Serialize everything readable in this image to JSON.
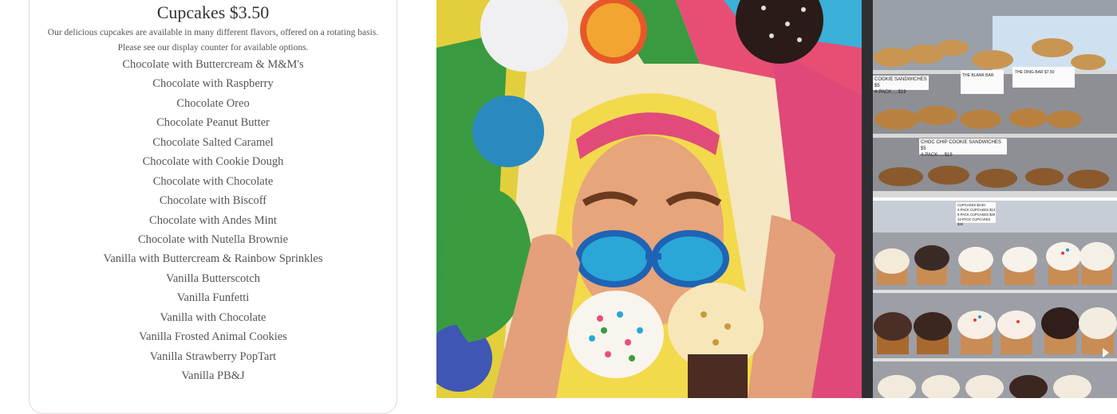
{
  "menu": {
    "title": "Cupcakes $3.50",
    "description_line1": "Our delicious cupcakes are available in many different flavors, offered on a rotating basis.",
    "description_line2": "Please see our display counter for available options.",
    "items": [
      "Chocolate with Buttercream & M&M's",
      "Chocolate with Raspberry",
      "Chocolate Oreo",
      "Chocolate Peanut Butter",
      "Chocolate Salted Caramel",
      "Chocolate with Cookie Dough",
      "Chocolate with Chocolate",
      "Chocolate with Biscoff",
      "Chocolate with Andes Mint",
      "Chocolate with Nutella Brownie",
      "Vanilla with Buttercream & Rainbow Sprinkles",
      "Vanilla Butterscotch",
      "Vanilla Funfetti",
      "Vanilla with Chocolate",
      "Vanilla Frosted Animal Cookies",
      "Vanilla Strawberry PopTart",
      "Vanilla PB&J"
    ]
  },
  "photos": {
    "mural": {
      "alt_colors": {
        "green": "#3b9b3f",
        "pink": "#e04b7a",
        "yellow": "#f3d34a",
        "blue": "#2b8fd6"
      }
    },
    "cookie_case": {
      "labels": [
        "COOKIE SANDWICHES $5",
        "4-PACK.....$19",
        "THE BLANK BAR",
        "THE DING BAR $7.50",
        "CHOC CHIP COOKIE SANDWICHES $5",
        "4-PACK.....$19"
      ]
    },
    "cupcake_case": {
      "labels": [
        "CUPCAKES $3.50",
        "4-PACK CUPCAKES $13",
        "6-PACK CUPCAKES $20",
        "12-PACK CUPCAKES $38"
      ]
    }
  }
}
